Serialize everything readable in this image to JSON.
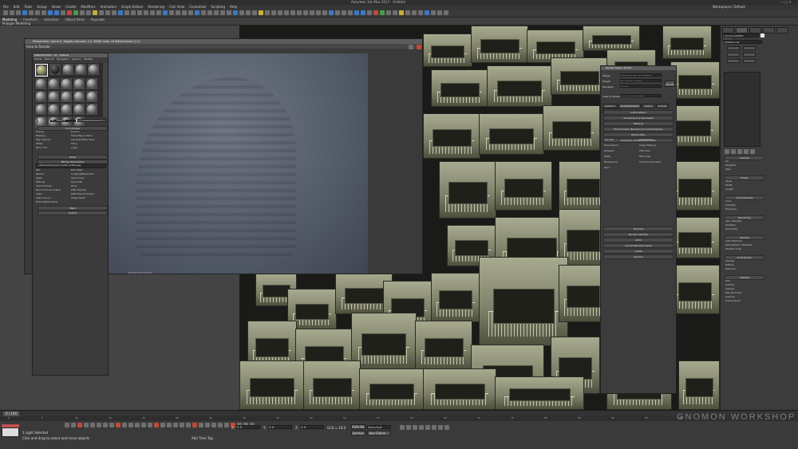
{
  "app": {
    "title": "Autodesk 3ds Max 2017 - Untitled",
    "workspace": "Workspaces: Default"
  },
  "menu": [
    "File",
    "Edit",
    "Tools",
    "Group",
    "Views",
    "Create",
    "Modifiers",
    "Animation",
    "Graph Editors",
    "Rendering",
    "Civil View",
    "Customize",
    "Scripting",
    "Help"
  ],
  "ribbon": {
    "tabs": [
      "Modeling",
      "Freeform",
      "Selection",
      "Object Paint",
      "Populate"
    ],
    "sub_label": "Polygon Modeling"
  },
  "viewport": {
    "label": "[+] [Perspective] [ Realistic ]"
  },
  "render_window": {
    "title": "Perspective, frame 0, Display Gamma: 2.2, RGBA Color 16 Bits/Channel (1:1)",
    "area_label": "Area to Render",
    "status": "Rendering Finished"
  },
  "material_editor": {
    "title": "Material Editor - 01 - Default",
    "menu": [
      "Modes",
      "Material",
      "Navigation",
      "Options",
      "Utilities"
    ],
    "material_name": "01 - Default",
    "type": "Arch & Design",
    "sections": [
      "Coordinates",
      "Noise",
      "Bitmap Parameters",
      "Maps",
      "Output"
    ],
    "bitmap_path": "...s\\Textures\\Dusty\\Concrete01_Diffuse.jpg",
    "labels": [
      "Texture",
      "Environ",
      "Mapping",
      "Show Map on Back",
      "Map Channel",
      "Use Real-World Scale",
      "Offset",
      "Tiling",
      "Mirror Tile",
      "Angle",
      "Blur",
      "Blur offset",
      "Reload",
      "Cropping/Placement",
      "Apply",
      "View Image",
      "Filtering",
      "Pyramidal",
      "Summed Area",
      "None",
      "Mono Channel Output",
      "RGB Intensity",
      "Alpha",
      "RGB Channel Output",
      "Alpha Source",
      "Image Alpha",
      "Premultiplied Alpha"
    ]
  },
  "render_setup": {
    "title": "Render Setup: Arnold",
    "target_label": "Target:",
    "target_value": "Production Rendering Mode",
    "preset_label": "Preset:",
    "preset_value": "No preset selected",
    "renderer_label": "Renderer:",
    "renderer_value": "Arnold",
    "view_label": "View to Render:",
    "view_value": "Quad 4 - Perspective",
    "render_button": "Render",
    "tabs": [
      "Common",
      "Arnold Renderer",
      "System",
      "Archive",
      "Diagnostics"
    ],
    "rollouts_top": [
      "Authorization",
      "Sampling and Ray Depth",
      "Filtering",
      "Environment, Background & Atmosphere",
      "Motion Blur",
      "Geometry, Subdivision & Hair"
    ],
    "rollouts_bottom": [
      "Textures",
      "Render Settings",
      "AOVs",
      "Arnold Renderer Setup",
      "Lights",
      "Gamma"
    ],
    "mid_labels": [
      "Use GPU",
      "Atmosphere",
      "Environment",
      "Image Filtering",
      "Gaussian",
      "Filter Size",
      "Width",
      "Filter Type",
      "Background",
      "Scene Environment",
      "Open"
    ]
  },
  "command_panel": {
    "tabs": [
      "Create",
      "Modify",
      "Hierarchy",
      "Motion",
      "Display",
      "Utilities"
    ],
    "object_name": "Arnold Light001",
    "modifier_list": "Modifier List",
    "sections": [
      "General",
      "Shape",
      "Color/Intensity",
      "Rendering",
      "Shadow",
      "Contribution",
      "Visibility"
    ],
    "labels": [
      "On",
      "Targeted",
      "Type",
      "Quad",
      "Width",
      "Length",
      "Color",
      "Intensity",
      "Exposure",
      "Res. Intensity",
      "Samples",
      "Normalize",
      "Cast Shadows",
      "Atmospheric Shadows",
      "Shadow Color",
      "Density",
      "Diffuse",
      "Specular",
      "SSS",
      "Indirect",
      "Volume",
      "Max Bounces",
      "Camera",
      "Transmission"
    ]
  },
  "timeline": {
    "frame_label": "0 / 100",
    "ticks": [
      "0",
      "5",
      "10",
      "15",
      "20",
      "25",
      "30",
      "35",
      "40",
      "45",
      "50",
      "55",
      "60",
      "65",
      "70",
      "75",
      "80",
      "85",
      "90",
      "95",
      "100"
    ]
  },
  "status": {
    "selection": "1 Light Selected",
    "prompt": "Click and drag to select and move objects",
    "x_label": "X:",
    "x_value": "0.0",
    "y_label": "Y:",
    "y_value": "0.0",
    "z_label": "Z:",
    "z_value": "0.0",
    "grid": "Grid = 10.0",
    "auto_key": "Auto Key",
    "set_key": "Set Key",
    "selected": "Selected",
    "key_filters": "Key Filters...",
    "add_time_tag": "Add Time Tag"
  },
  "logo": {
    "text": "GNOMON WORKSHOP"
  },
  "colors": {
    "ui_bg": "#444444",
    "panel": "#3d3d3d",
    "accent_blue": "#3a78c8",
    "fog": "#5a6270"
  }
}
